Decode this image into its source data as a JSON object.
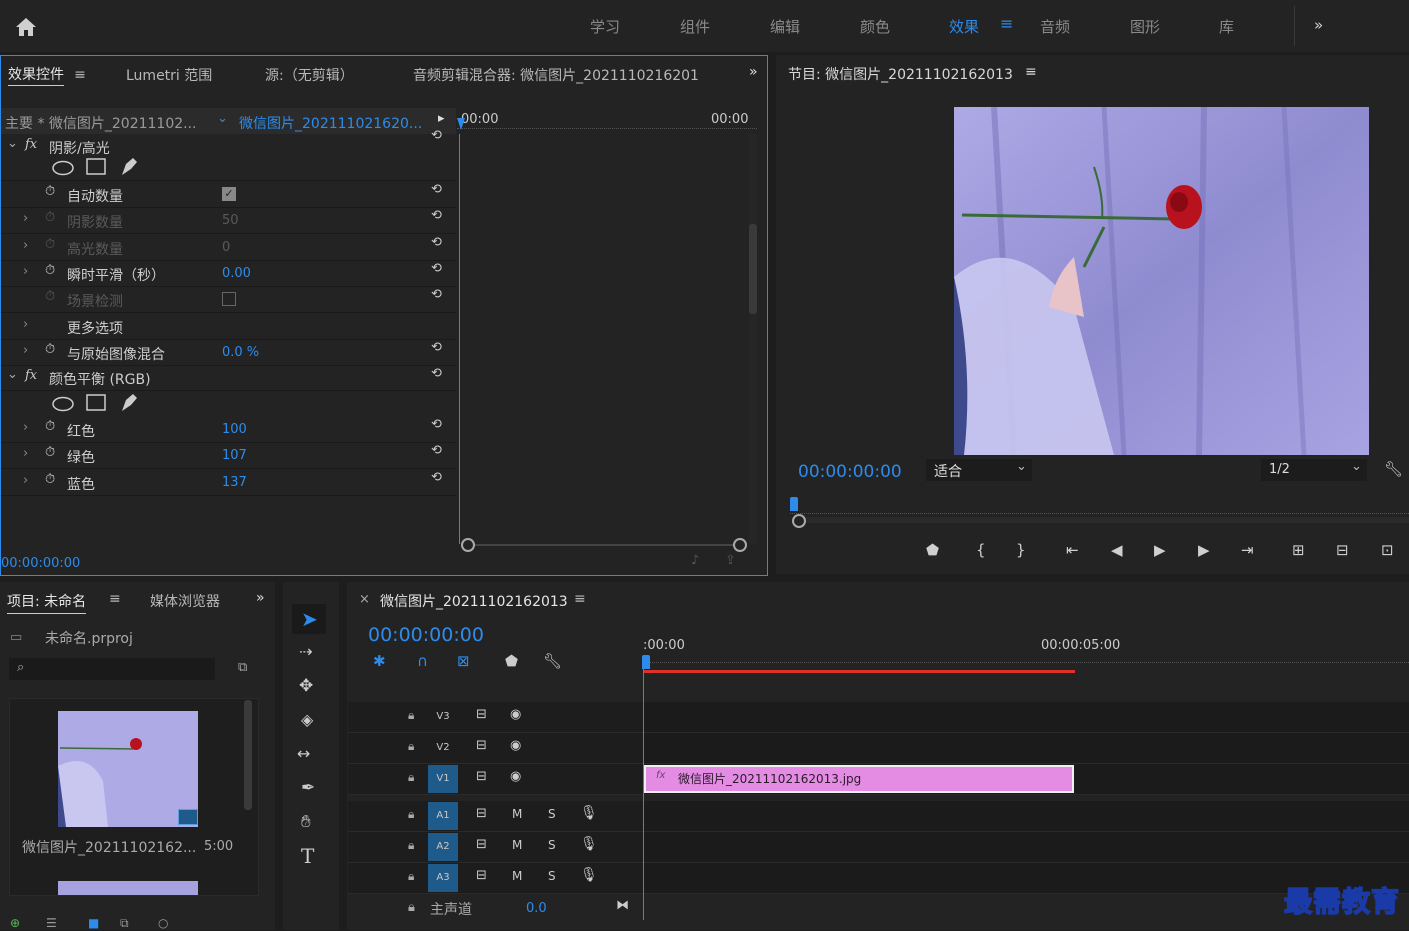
{
  "workspace": {
    "tabs": [
      "学习",
      "组件",
      "编辑",
      "颜色",
      "效果",
      "音频",
      "图形",
      "库"
    ],
    "active": "效果",
    "more": "»"
  },
  "source_panel": {
    "tabs": [
      "效果控件",
      "Lumetri 范围",
      "源:（无剪辑）",
      "音频剪辑混合器: 微信图片_2021110216201"
    ],
    "master_label": "主要 * 微信图片_20211102...",
    "clip_label": "微信图片_202111021620...",
    "time_start": "00:00",
    "time_end": "00:00",
    "current_time": "00:00:00:00",
    "effects": [
      {
        "name": "阴影/高光",
        "props": [
          {
            "label": "自动数量",
            "value": "",
            "type": "checkbox-checked"
          },
          {
            "label": "阴影数量",
            "value": "50",
            "disabled": true
          },
          {
            "label": "高光数量",
            "value": "0",
            "disabled": true
          },
          {
            "label": "瞬时平滑（秒）",
            "value": "0.00"
          },
          {
            "label": "场景检测",
            "value": "",
            "type": "checkbox",
            "disabled": true
          },
          {
            "label": "更多选项",
            "value": ""
          },
          {
            "label": "与原始图像混合",
            "value": "0.0 %"
          }
        ]
      },
      {
        "name": "颜色平衡 (RGB)",
        "props": [
          {
            "label": "红色",
            "value": "100"
          },
          {
            "label": "绿色",
            "value": "107"
          },
          {
            "label": "蓝色",
            "value": "137"
          }
        ]
      }
    ]
  },
  "program_panel": {
    "title": "节目: 微信图片_20211102162013",
    "timecode": "00:00:00:00",
    "fit": "适合",
    "resolution": "1/2"
  },
  "project_panel": {
    "tabs": [
      "项目: 未命名",
      "媒体浏览器"
    ],
    "project_file": "未命名.prproj",
    "search_placeholder": "",
    "item_name": "微信图片_20211102162...",
    "item_duration": "5:00"
  },
  "timeline": {
    "title": "微信图片_20211102162013",
    "timecode": "00:00:00:00",
    "ruler_start": ":00:00",
    "ruler_mid": "00:00:05:00",
    "clip_name": "微信图片_20211102162013.jpg",
    "video_tracks": [
      "V3",
      "V2",
      "V1"
    ],
    "audio_tracks": [
      "A1",
      "A2",
      "A3"
    ],
    "master_label": "主声道",
    "master_value": "0.0",
    "m": "M",
    "s": "S"
  },
  "watermark": "最需教育",
  "colors": {
    "accent": "#2d8ceb",
    "clip": "#e48ce4",
    "playhead_bar": "#e0302a"
  }
}
